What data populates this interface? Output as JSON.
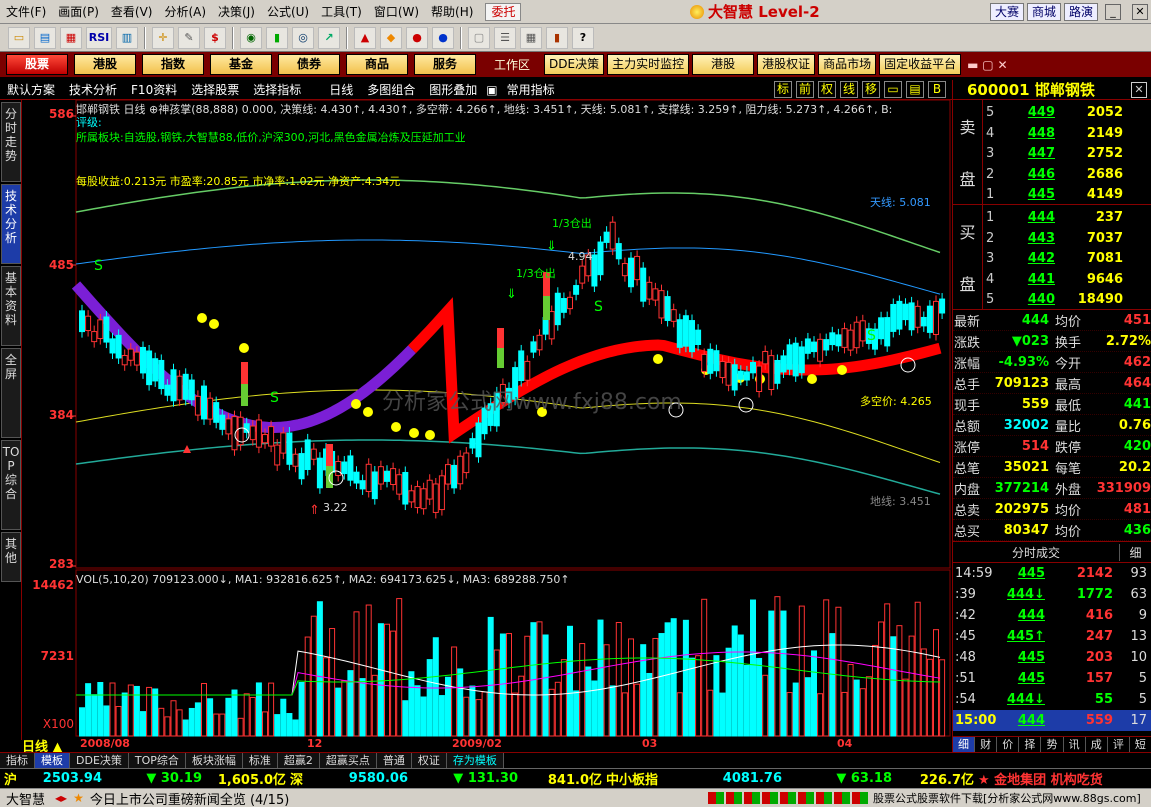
{
  "menu": {
    "items": [
      "文件(F)",
      "画面(P)",
      "查看(V)",
      "分析(A)",
      "决策(J)",
      "公式(U)",
      "工具(T)",
      "窗口(W)",
      "帮助(H)"
    ],
    "stock_tab": "委托",
    "brand": "大智慧 Level-2",
    "right_buttons": [
      "大赛",
      "商城",
      "路演"
    ]
  },
  "toolbar": {
    "icons": [
      "folder-open-icon",
      "chart-icon",
      "grid-icon",
      "rsi-icon",
      "table-icon",
      "crosshair-icon",
      "draw-line-icon",
      "dollar-icon",
      "eye-icon",
      "bars-icon",
      "binoculars-icon",
      "chart-arrow-icon",
      "alert-icon",
      "diamond-icon",
      "money-icon",
      "circle-icon",
      "notes-icon",
      "list-icon",
      "calendar-icon",
      "books-icon",
      "help-cursor-icon"
    ],
    "rsi_label": "RSI",
    "dollar_label": "$"
  },
  "nav": {
    "tabs": [
      "股票",
      "港股",
      "指数",
      "基金",
      "债券",
      "商品",
      "服务"
    ],
    "workspace": "工作区",
    "tabs2": [
      "DDE决策",
      "主力实时监控",
      "港股",
      "港股权证",
      "商品市场",
      "固定收益平台"
    ]
  },
  "subtool": {
    "items": [
      "默认方案",
      "技术分析",
      "F10资料",
      "选择股票",
      "选择指标",
      "日线",
      "多图组合",
      "图形叠加",
      "常用指标"
    ],
    "right_boxes": [
      "标",
      "前",
      "权",
      "线",
      "移"
    ]
  },
  "left_tabs": [
    "分时走势",
    "技术分析",
    "基本资料",
    "全屏",
    "TOP综合",
    "其他"
  ],
  "left_active": 1,
  "chart": {
    "header": "邯郸钢铁 日线 ⊕神孩掌(88,888)  0.000, 决策线: 4.430↑, 4.430↑, 多空带: 4.266↑, 地线: 3.451↑, 天线: 5.081↑, 支撑线: 3.259↑, 阻力线: 5.273↑, 4.266↑, B:",
    "rating": "评级:",
    "sector": "所属板块:自选股,钢铁,大智慧88,低价,沪深300,河北,黑色金属冶炼及压延加工业",
    "fundamentals": "每股收益:0.213元 市盈率:20.85元 市净率:1.02元 净资产:4.34元",
    "tianxian": "天线: 5.081",
    "dixian": "地线: 3.451",
    "duokong": "多空价: 4.265",
    "cangchu1": "1/3仓出",
    "cangchu2": "1/3仓出",
    "low_label": "3.22",
    "high_label": "4.94",
    "price_axis": [
      "586",
      "485",
      "384",
      "283"
    ],
    "vol_axis": [
      "14462",
      "7231",
      "X100"
    ],
    "vol_header": "VOL(5,10,20) 709123.000↓, MA1: 932816.625↑, MA2: 694173.625↓, MA3: 689288.750↑",
    "x_labels": [
      "2008/08",
      "12",
      "2009/02",
      "03",
      "04"
    ],
    "period_label": "日线",
    "watermark": "分析家公式网www.fxj88.com"
  },
  "stock": {
    "code_name": "600001 邯郸钢铁",
    "sell_label": [
      "卖",
      "盘"
    ],
    "buy_label": [
      "买",
      "盘"
    ],
    "asks": [
      {
        "i": "5",
        "p": "449",
        "v": "2052"
      },
      {
        "i": "4",
        "p": "448",
        "v": "2149"
      },
      {
        "i": "3",
        "p": "447",
        "v": "2752"
      },
      {
        "i": "2",
        "p": "446",
        "v": "2686"
      },
      {
        "i": "1",
        "p": "445",
        "v": "4149"
      }
    ],
    "bids": [
      {
        "i": "1",
        "p": "444",
        "v": "237"
      },
      {
        "i": "2",
        "p": "443",
        "v": "7037"
      },
      {
        "i": "3",
        "p": "442",
        "v": "7081"
      },
      {
        "i": "4",
        "p": "441",
        "v": "9646"
      },
      {
        "i": "5",
        "p": "440",
        "v": "18490"
      }
    ],
    "quotes": [
      {
        "k": "最新",
        "v": "444",
        "vc": "#0f0",
        "k2": "均价",
        "v2": "451",
        "v2c": "#f33"
      },
      {
        "k": "涨跌",
        "v": "▼023",
        "vc": "#0f0",
        "k2": "换手",
        "v2": "2.72%",
        "v2c": "#ff0"
      },
      {
        "k": "涨幅",
        "v": "-4.93%",
        "vc": "#0f0",
        "k2": "今开",
        "v2": "462",
        "v2c": "#f33"
      },
      {
        "k": "总手",
        "v": "709123",
        "vc": "#ff0",
        "k2": "最高",
        "v2": "464",
        "v2c": "#f33"
      },
      {
        "k": "现手",
        "v": "559",
        "vc": "#ff0",
        "k2": "最低",
        "v2": "441",
        "v2c": "#0f0"
      },
      {
        "k": "总额",
        "v": "32002",
        "vc": "#0ff",
        "k2": "量比",
        "v2": "0.76",
        "v2c": "#ff0"
      },
      {
        "k": "涨停",
        "v": "514",
        "vc": "#f33",
        "k2": "跌停",
        "v2": "420",
        "v2c": "#0f0"
      },
      {
        "k": "总笔",
        "v": "35021",
        "vc": "#ff0",
        "k2": "每笔",
        "v2": "20.2",
        "v2c": "#ff0"
      },
      {
        "k": "内盘",
        "v": "377214",
        "vc": "#0f0",
        "k2": "外盘",
        "v2": "331909",
        "v2c": "#f33"
      },
      {
        "k": "总卖",
        "v": "202975",
        "vc": "#ff0",
        "k2": "均价",
        "v2": "481",
        "v2c": "#f33"
      },
      {
        "k": "总买",
        "v": "80347",
        "vc": "#ff0",
        "k2": "均价",
        "v2": "436",
        "v2c": "#0f0"
      }
    ],
    "trade_header": "分时成交",
    "trade_detail": "细",
    "trades": [
      {
        "t": "14:59",
        "p": "445",
        "v": "2142",
        "vc": "#f33",
        "n": "93"
      },
      {
        "t": ":39",
        "p": "444↓",
        "v": "1772",
        "vc": "#0f0",
        "n": "63"
      },
      {
        "t": ":42",
        "p": "444",
        "v": "416",
        "vc": "#f33",
        "n": "9"
      },
      {
        "t": ":45",
        "p": "445↑",
        "v": "247",
        "vc": "#f33",
        "n": "13"
      },
      {
        "t": ":48",
        "p": "445",
        "v": "203",
        "vc": "#f33",
        "n": "10"
      },
      {
        "t": ":51",
        "p": "445",
        "v": "157",
        "vc": "#f33",
        "n": "5"
      },
      {
        "t": ":54",
        "p": "444↓",
        "v": "55",
        "vc": "#0f0",
        "n": "5"
      },
      {
        "t": "15:00",
        "p": "444",
        "v": "559",
        "vc": "#f33",
        "n": "17"
      }
    ],
    "right_tabs": [
      "细",
      "财",
      "价",
      "择",
      "势",
      "讯",
      "成",
      "评",
      "短"
    ]
  },
  "bottom_tabs": [
    "指标",
    "模板",
    "DDE决策",
    "TOP综合",
    "板块涨幅",
    "标准",
    "超赢2",
    "超赢买点",
    "普通",
    "权证",
    "存为模板"
  ],
  "bottom_active": 1,
  "index_bar": [
    {
      "t": "沪",
      "c": "#ff0"
    },
    {
      "t": "2503.94",
      "c": "#0ff"
    },
    {
      "t": "▼ 30.19",
      "c": "#0f0"
    },
    {
      "t": "1,605.0亿",
      "c": "#ff0"
    },
    {
      "t": "深",
      "c": "#ff0"
    },
    {
      "t": "9580.06",
      "c": "#0ff"
    },
    {
      "t": "▼ 131.30",
      "c": "#0f0"
    },
    {
      "t": "841.0亿",
      "c": "#ff0"
    },
    {
      "t": "中小板指",
      "c": "#ff0"
    },
    {
      "t": "4081.76",
      "c": "#0ff"
    },
    {
      "t": "▼ 63.18",
      "c": "#0f0"
    },
    {
      "t": "226.7亿",
      "c": "#ff0"
    },
    {
      "t": "★ 金地集团 机构吃货",
      "c": "#f33"
    }
  ],
  "status": {
    "app": "大智慧",
    "news": "今日上市公司重磅新闻全览 (4/15)",
    "right": "股票公式股票软件下载[分析家公式网www.88gs.com]"
  }
}
